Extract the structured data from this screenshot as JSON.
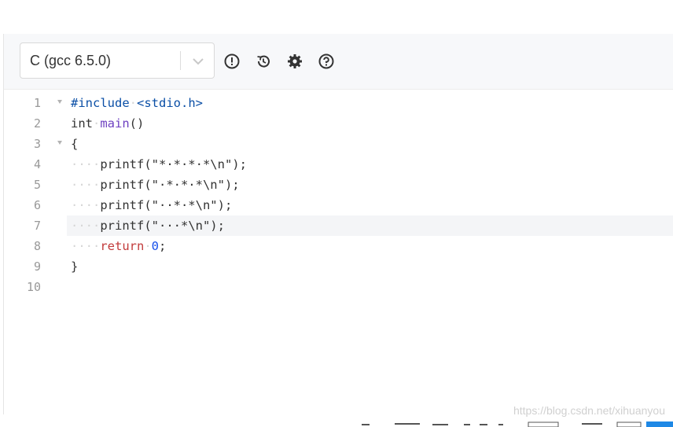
{
  "toolbar": {
    "language": "C (gcc 6.5.0)",
    "icons": [
      "info-icon",
      "history-icon",
      "gear-icon",
      "help-icon"
    ]
  },
  "editor": {
    "active_line": 7,
    "lines": [
      {
        "n": "1",
        "fold": true
      },
      {
        "n": "2",
        "fold": false
      },
      {
        "n": "3",
        "fold": true
      },
      {
        "n": "4",
        "fold": false
      },
      {
        "n": "5",
        "fold": false
      },
      {
        "n": "6",
        "fold": false
      },
      {
        "n": "7",
        "fold": false
      },
      {
        "n": "8",
        "fold": false
      },
      {
        "n": "9",
        "fold": false
      },
      {
        "n": "10",
        "fold": false
      }
    ],
    "tokens": {
      "l1_a": "#include",
      "l1_b": "<stdio.h>",
      "l2_a": "int",
      "l2_b": "main",
      "l2_c": "()",
      "l3": "{",
      "l4": "printf(\"*·*·*·*\\n\");",
      "l5": "printf(\"·*·*·*\\n\");",
      "l6": "printf(\"··*·*\\n\");",
      "l7": "printf(\"···*\\n\");",
      "l8_a": "return",
      "l8_b": "0",
      "l8_c": ";",
      "l9": "}",
      "indent": "····",
      "ws": "·"
    }
  },
  "watermark": "https://blog.csdn.net/xihuanyou",
  "colors": {
    "toolbar_bg": "#f7f8fa",
    "keyword_pp": "#0b4fa6",
    "function": "#6f42c1",
    "return": "#c23b3b",
    "number": "#1750eb"
  }
}
